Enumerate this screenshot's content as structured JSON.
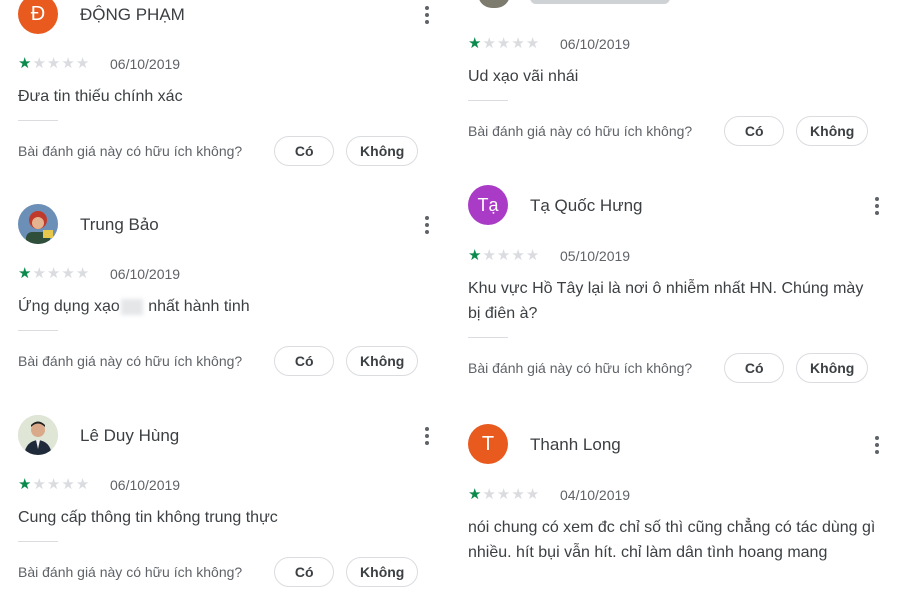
{
  "helpful_question": "Bài đánh giá này có hữu ích không?",
  "yes_label": "Có",
  "no_label": "Không",
  "colors": {
    "star_filled": "#0b8a4c",
    "star_empty": "#dadce0",
    "avatar_orange": "#e85a1e",
    "avatar_purple": "#a93bc6"
  },
  "reviews_left": [
    {
      "initial": "Đ",
      "name": "ĐỘNG PHẠM",
      "rating": 1,
      "date": "06/10/2019",
      "text": "Đưa tin thiếu chính xác"
    },
    {
      "name": "Trung Bảo",
      "rating": 1,
      "date": "06/10/2019",
      "text_before": "Ứng dụng xạo",
      "text_after": " nhất hành tinh"
    },
    {
      "name": "Lê Duy Hùng",
      "rating": 1,
      "date": "06/10/2019",
      "text": "Cung cấp thông tin không trung thực"
    }
  ],
  "reviews_right": [
    {
      "rating": 1,
      "date": "06/10/2019",
      "text": "Ud xạo vãi nhái"
    },
    {
      "initial": "Tạ",
      "name": "Tạ Quốc Hưng",
      "rating": 1,
      "date": "05/10/2019",
      "text": "Khu vực Hồ Tây lại là nơi ô nhiễm nhất HN. Chúng mày bị điên à?"
    },
    {
      "initial": "T",
      "name": "Thanh Long",
      "rating": 1,
      "date": "04/10/2019",
      "text": "nói chung có xem đc chỉ số thì cũng chẳng có tác dùng gì nhiều. hít bụi vẫn hít. chỉ làm dân tình hoang mang"
    }
  ]
}
